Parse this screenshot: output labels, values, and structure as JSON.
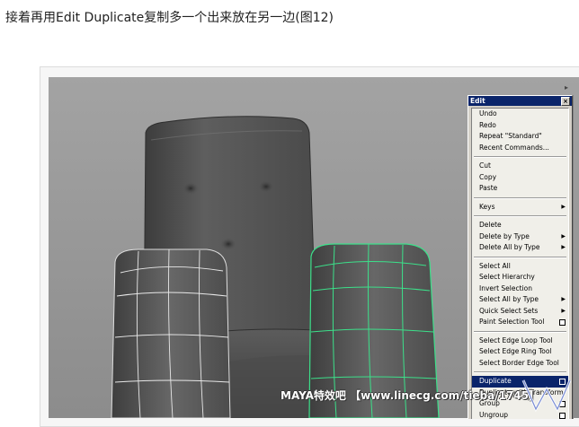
{
  "caption": "接着再用Edit Duplicate复制多一个出来放在另一边(图12)",
  "menu": {
    "title": "Edit",
    "close": "×",
    "groups": [
      [
        {
          "label": "Undo"
        },
        {
          "label": "Redo"
        },
        {
          "label": "Repeat \"Standard\""
        },
        {
          "label": "Recent Commands..."
        }
      ],
      [
        {
          "label": "Cut"
        },
        {
          "label": "Copy"
        },
        {
          "label": "Paste"
        }
      ],
      [
        {
          "label": "Keys",
          "submenu": true
        }
      ],
      [
        {
          "label": "Delete"
        },
        {
          "label": "Delete by Type",
          "submenu": true
        },
        {
          "label": "Delete All by Type",
          "submenu": true
        }
      ],
      [
        {
          "label": "Select All"
        },
        {
          "label": "Select Hierarchy"
        },
        {
          "label": "Invert Selection"
        },
        {
          "label": "Select All by Type",
          "submenu": true
        },
        {
          "label": "Quick Select Sets",
          "submenu": true
        },
        {
          "label": "Paint Selection Tool",
          "option": true
        }
      ],
      [
        {
          "label": "Select Edge Loop Tool"
        },
        {
          "label": "Select Edge Ring Tool"
        },
        {
          "label": "Select Border Edge Tool"
        }
      ],
      [
        {
          "label": "Duplicate",
          "option": true,
          "selected": true
        },
        {
          "label": "Duplicate with Transform"
        },
        {
          "label": "Group",
          "option": true
        },
        {
          "label": "Ungroup",
          "option": true
        }
      ]
    ]
  },
  "watermark": "MAYA特效吧 【www.linecg.com/tieba/1745】",
  "colors": {
    "viewport_bg": "#9c9c9c",
    "menu_bg": "#d4d0c8",
    "selection": "#0a246a",
    "selected_wire": "#3ce08a"
  }
}
